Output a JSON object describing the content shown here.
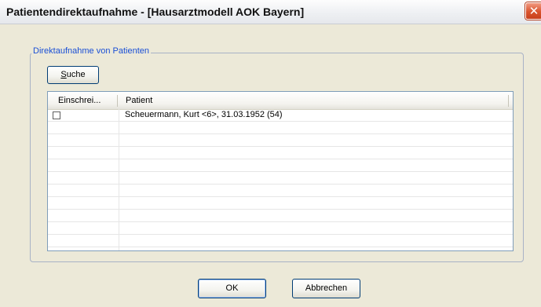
{
  "window": {
    "title": "Patientendirektaufnahme - [Hausarztmodell AOK Bayern]",
    "close_glyph": "✕"
  },
  "group": {
    "legend": "Direktaufnahme von Patienten"
  },
  "search_button": {
    "mnemonic": "S",
    "rest": "uche"
  },
  "table": {
    "columns": [
      "Einschrei...",
      "Patient"
    ],
    "rows": [
      {
        "enrolled": false,
        "patient": "Scheuermann, Kurt <6>, 31.03.1952 (54)"
      }
    ]
  },
  "footer": {
    "ok_label": "OK",
    "cancel_label": "Abbrechen"
  }
}
